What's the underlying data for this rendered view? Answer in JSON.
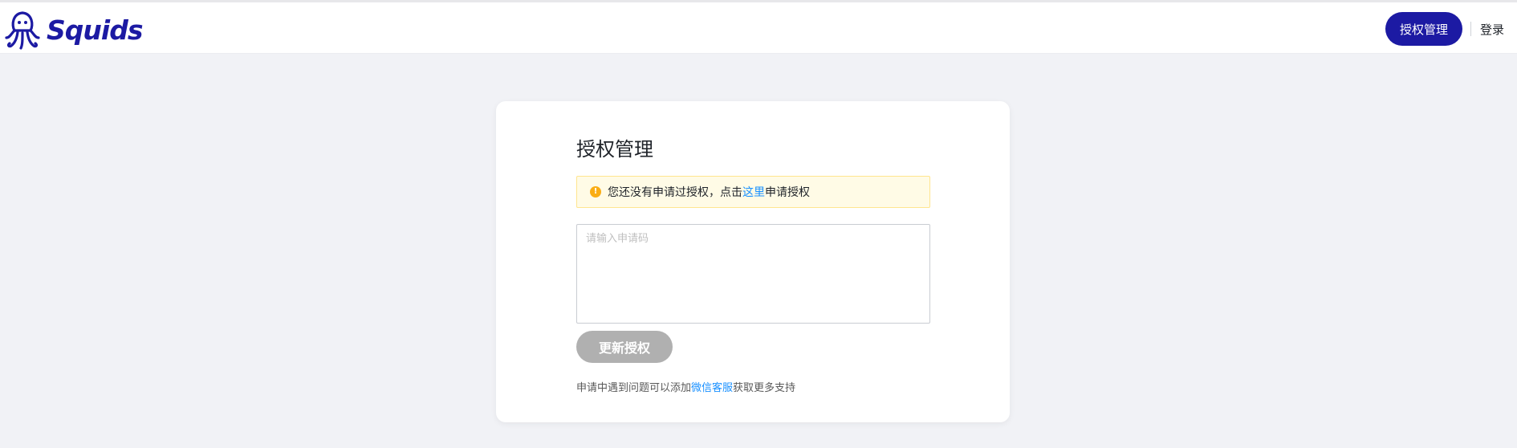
{
  "header": {
    "logo_text": "Squids",
    "nav_auth_button": "授权管理",
    "nav_login": "登录"
  },
  "card": {
    "title": "授权管理",
    "alert": {
      "text_before": "您还没有申请过授权，点击",
      "link_text": "这里",
      "text_after": "申请授权"
    },
    "input": {
      "placeholder": "请输入申请码",
      "value": ""
    },
    "update_button": "更新授权",
    "help": {
      "text_before": "申请中遇到问题可以添加",
      "link_text": "微信客服",
      "text_after": "获取更多支持"
    }
  },
  "colors": {
    "brand": "#1c1aa3",
    "background": "#f1f2f6",
    "link": "#1890ff",
    "warning": "#faad14",
    "disabled_button": "#b0b0b0"
  },
  "icons": {
    "logo": "squid-logo-icon",
    "alert": "exclamation-circle-icon"
  }
}
